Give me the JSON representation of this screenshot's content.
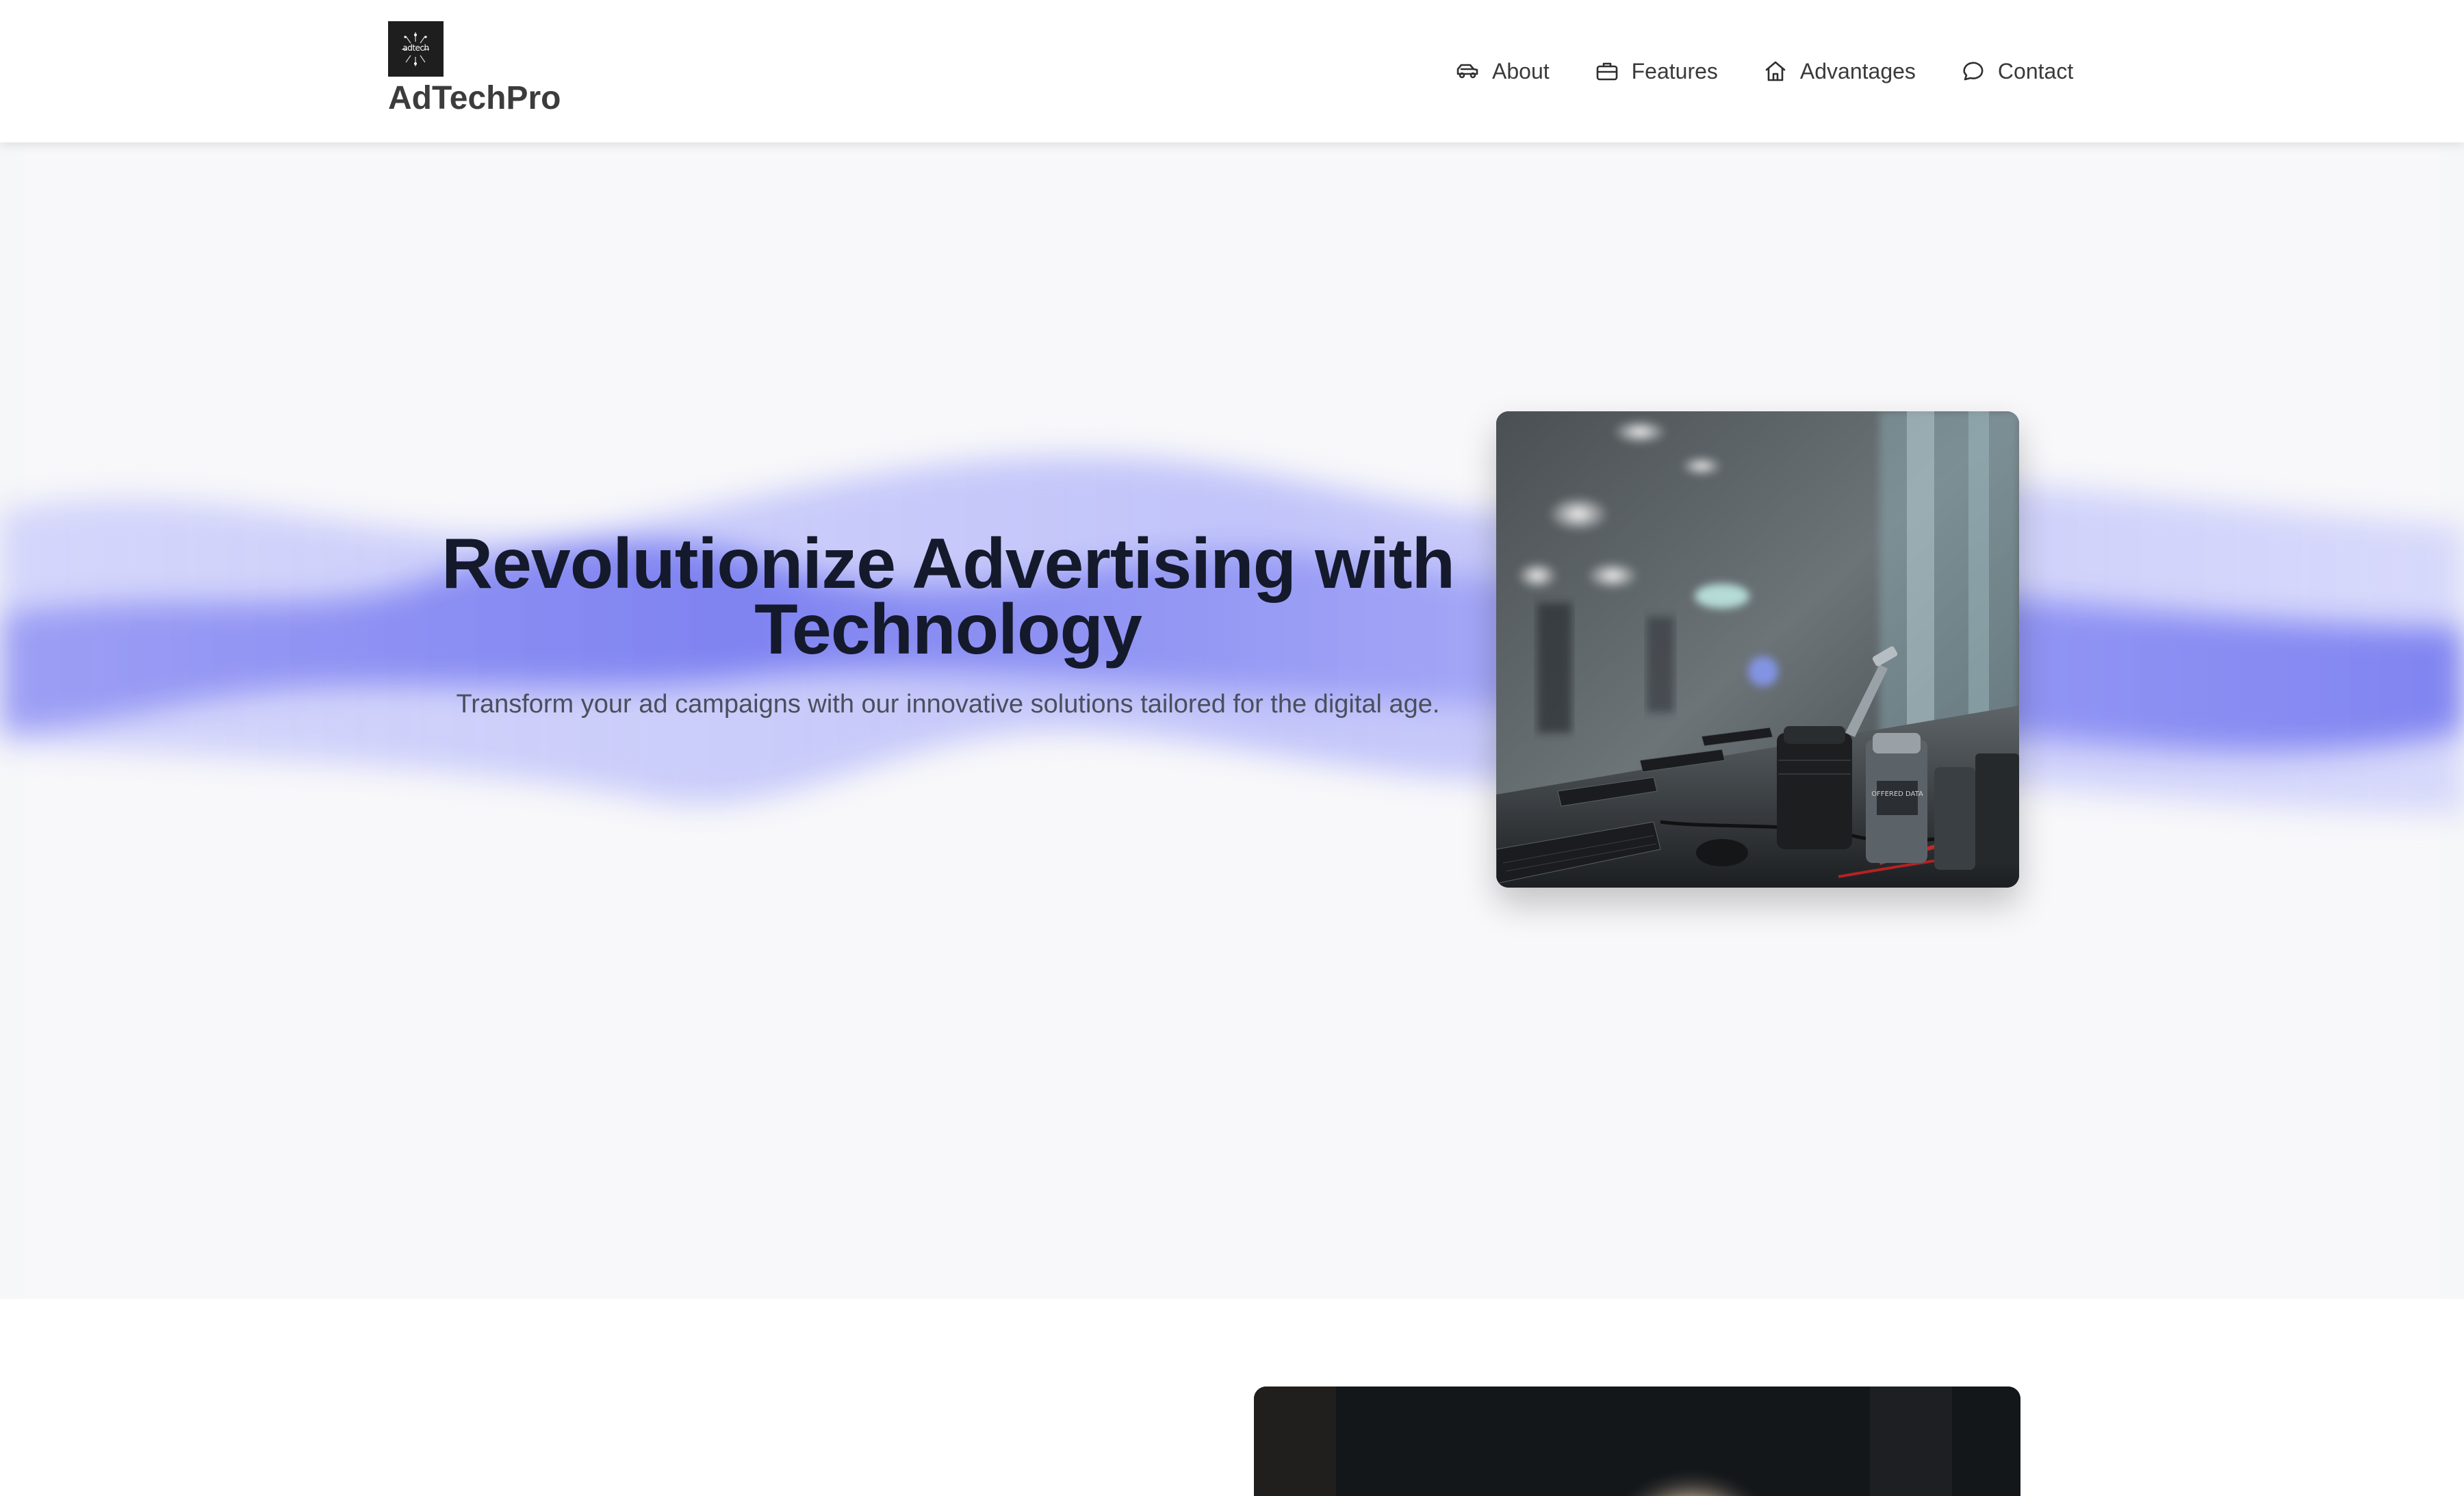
{
  "brand": {
    "logo_text": "adtech",
    "name": "AdTechPro"
  },
  "nav": {
    "items": [
      {
        "label": "About",
        "icon": "car-icon"
      },
      {
        "label": "Features",
        "icon": "briefcase-icon"
      },
      {
        "label": "Advantages",
        "icon": "home-icon"
      },
      {
        "label": "Contact",
        "icon": "chat-bubble-icon"
      }
    ]
  },
  "hero": {
    "title": "Revolutionize Advertising with Technology",
    "subtitle": "Transform your ad campaigns with our innovative solutions tailored for the digital age.",
    "image_caption": "OFFERED DATA"
  },
  "colors": {
    "wave_accent": "#7b7ff0",
    "hero_background": "#f6f7f9",
    "title_text": "#141a2b",
    "subtitle_text": "#4a4f5c",
    "nav_text": "#3a3a3a",
    "brand_text": "#3c3c3c"
  }
}
